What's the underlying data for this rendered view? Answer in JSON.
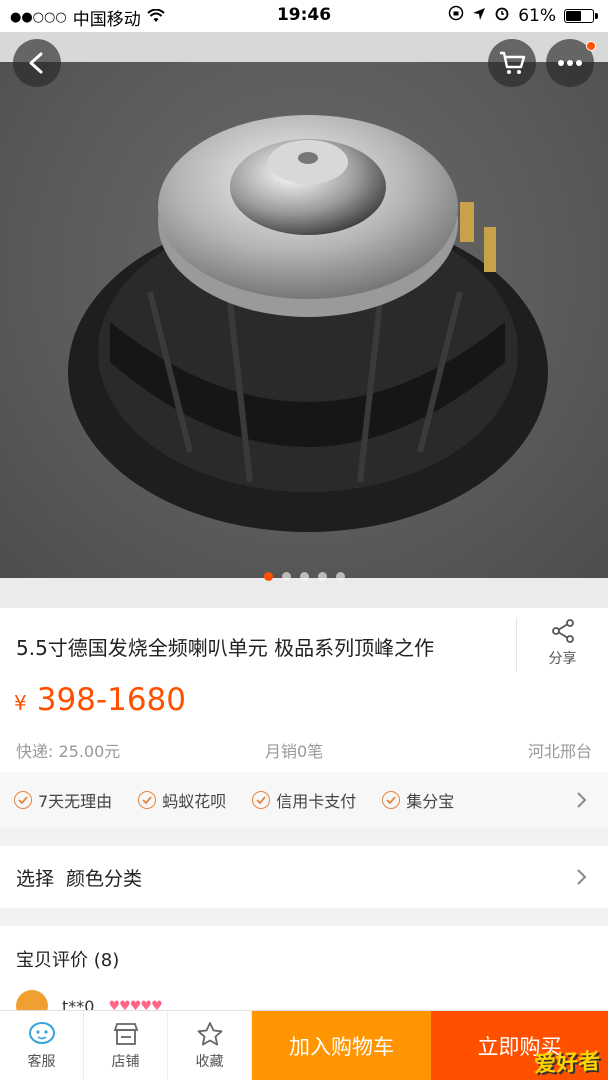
{
  "status_bar": {
    "signal": "●●○○○",
    "carrier": "中国移动",
    "time": "19:46",
    "battery_percent": "61%",
    "battery_level": 0.61
  },
  "gallery": {
    "total_images": 5,
    "active_index": 0
  },
  "product": {
    "title": "5.5寸德国发烧全频喇叭单元 极品系列顶峰之作",
    "share_label": "分享",
    "currency": "¥",
    "price": "398-1680",
    "shipping": "快递: 25.00元",
    "monthly_sales": "月销0笔",
    "location": "河北邢台"
  },
  "services": [
    "7天无理由",
    "蚂蚁花呗",
    "信用卡支付",
    "集分宝"
  ],
  "select": {
    "label": "选择",
    "value": "颜色分类"
  },
  "reviews": {
    "title": "宝贝评价 (8)",
    "first_reviewer": "t**0",
    "reviewer_level": "♥♥♥♥♥"
  },
  "bottom_bar": {
    "service_label": "客服",
    "shop_label": "店铺",
    "favorite_label": "收藏",
    "add_to_cart_label": "加入购物车",
    "buy_now_label": "立即购买",
    "watermark": "爱好者"
  },
  "colors": {
    "accent": "#ff5000",
    "cart_button": "#ff9500",
    "price": "#ff5000"
  }
}
